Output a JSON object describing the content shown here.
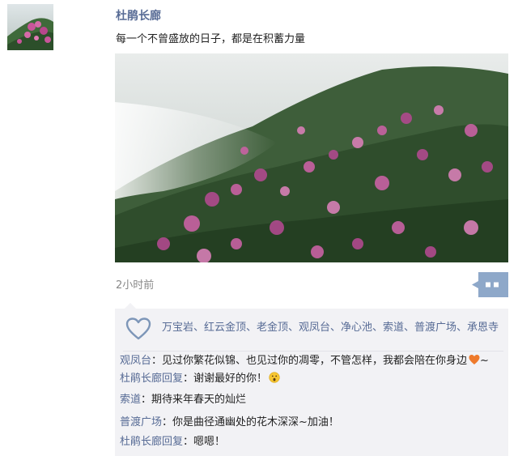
{
  "post": {
    "author": "杜鹃长廊",
    "text": "每一个不曾盛放的日子，都是在积蓄力量",
    "time": "2小时前"
  },
  "likes": {
    "names": "万宝岩、红云金顶、老金顶、观凤台、净心池、索道、普渡广场、承恩寺"
  },
  "comments": [
    {
      "author": "观凤台",
      "sep": "：",
      "text": "见过你繁花似锦、也见过你的凋零，不管怎样，我都会陪在你身边",
      "suffix": "~"
    },
    {
      "author": "杜鹃长廊回复",
      "sep": "：",
      "text": "谢谢最好的你！"
    },
    {
      "author": "索道",
      "sep": "：",
      "text": "期待来年春天的灿烂"
    },
    {
      "author": "普渡广场",
      "sep": "：",
      "text": "你是曲径通幽处的花木深深~加油！"
    },
    {
      "author": "杜鹃长廊回复",
      "sep": "：",
      "text": "嗯嗯！"
    }
  ],
  "colors": {
    "name_blue": "#576b95",
    "panel_bg": "#f2f2f5",
    "comment_button": "#8ea8c9"
  },
  "icons": {
    "like": "heart-outline-icon",
    "comment": "comment-dots-icon",
    "emoji_1": "orange-heart-emoji",
    "emoji_2": "surprised-face-emoji"
  }
}
